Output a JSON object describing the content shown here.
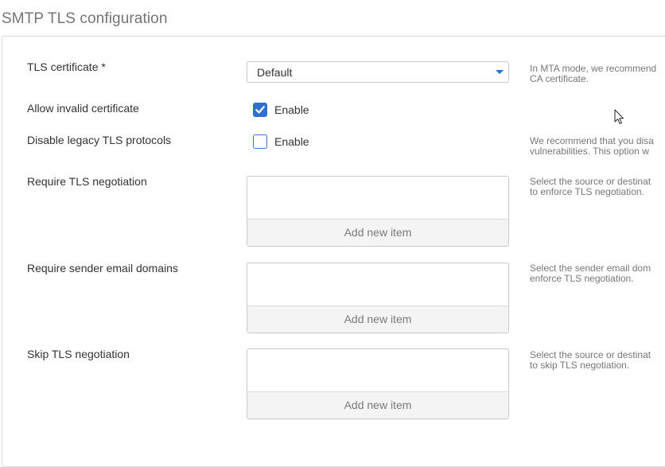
{
  "section": {
    "title": "SMTP TLS configuration"
  },
  "fields": {
    "tls_certificate": {
      "label": "TLS certificate *",
      "value": "Default",
      "help_line1": "In MTA mode, we recommend",
      "help_line2": "CA certificate."
    },
    "allow_invalid": {
      "label": "Allow invalid certificate",
      "checkbox_label": "Enable",
      "checked": true
    },
    "disable_legacy": {
      "label": "Disable legacy TLS protocols",
      "checkbox_label": "Enable",
      "checked": false,
      "help_line1": "We recommend that you disa",
      "help_line2": "vulnerabilities. This option w"
    },
    "require_tls": {
      "label": "Require TLS negotiation",
      "add_label": "Add new item",
      "help_line1": "Select the source or destinat",
      "help_line2": "to enforce TLS negotiation."
    },
    "require_sender": {
      "label": "Require sender email domains",
      "add_label": "Add new item",
      "help_line1": "Select the sender email dom",
      "help_line2": "enforce TLS negotiation."
    },
    "skip_tls": {
      "label": "Skip TLS negotiation",
      "add_label": "Add new item",
      "help_line1": "Select the source or destinat",
      "help_line2": "to skip TLS negotiation."
    }
  },
  "colors": {
    "accent": "#2f6fd1",
    "caret": "#1b73c9",
    "border": "#c9c9c9",
    "help_text": "#777777"
  },
  "icons": {
    "checkbox_checked": "checkmark-icon",
    "dropdown": "chevron-down-icon",
    "pointer": "mouse-cursor-icon"
  }
}
